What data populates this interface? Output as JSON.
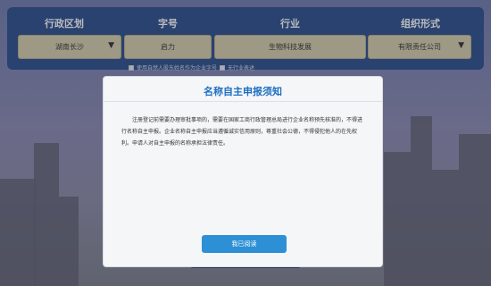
{
  "columns": [
    {
      "label": "行政区划",
      "value": "湖南长沙",
      "has_dropdown": true
    },
    {
      "label": "字号",
      "value": "启力",
      "has_dropdown": false
    },
    {
      "label": "行业",
      "value": "生物科技发展",
      "has_dropdown": false
    },
    {
      "label": "组织形式",
      "value": "有限责任公司",
      "has_dropdown": true
    }
  ],
  "options": {
    "use_natural_person_name": "使用自然人股东姓名作为企业字号",
    "no_industry": "无行业表述"
  },
  "modal": {
    "title": "名称自主申报须知",
    "body": "注册登记前需要办理审批事项的，需要在国家工商行政管理总局进行企业名称预先核准的，不得进行名称自主申报。企业名称自主申报应当遵循诚实信用原则，尊重社会公德，不得侵犯他人的在先权利。申请人对自主申报的名称承担法律责任。",
    "confirm_label": "我已阅读"
  },
  "icons": {
    "dropdown": "▼"
  },
  "colors": {
    "panel": "#2a4f8a",
    "field": "#d6ceaa",
    "title": "#1c6fc0",
    "button": "#2d8fd6"
  }
}
